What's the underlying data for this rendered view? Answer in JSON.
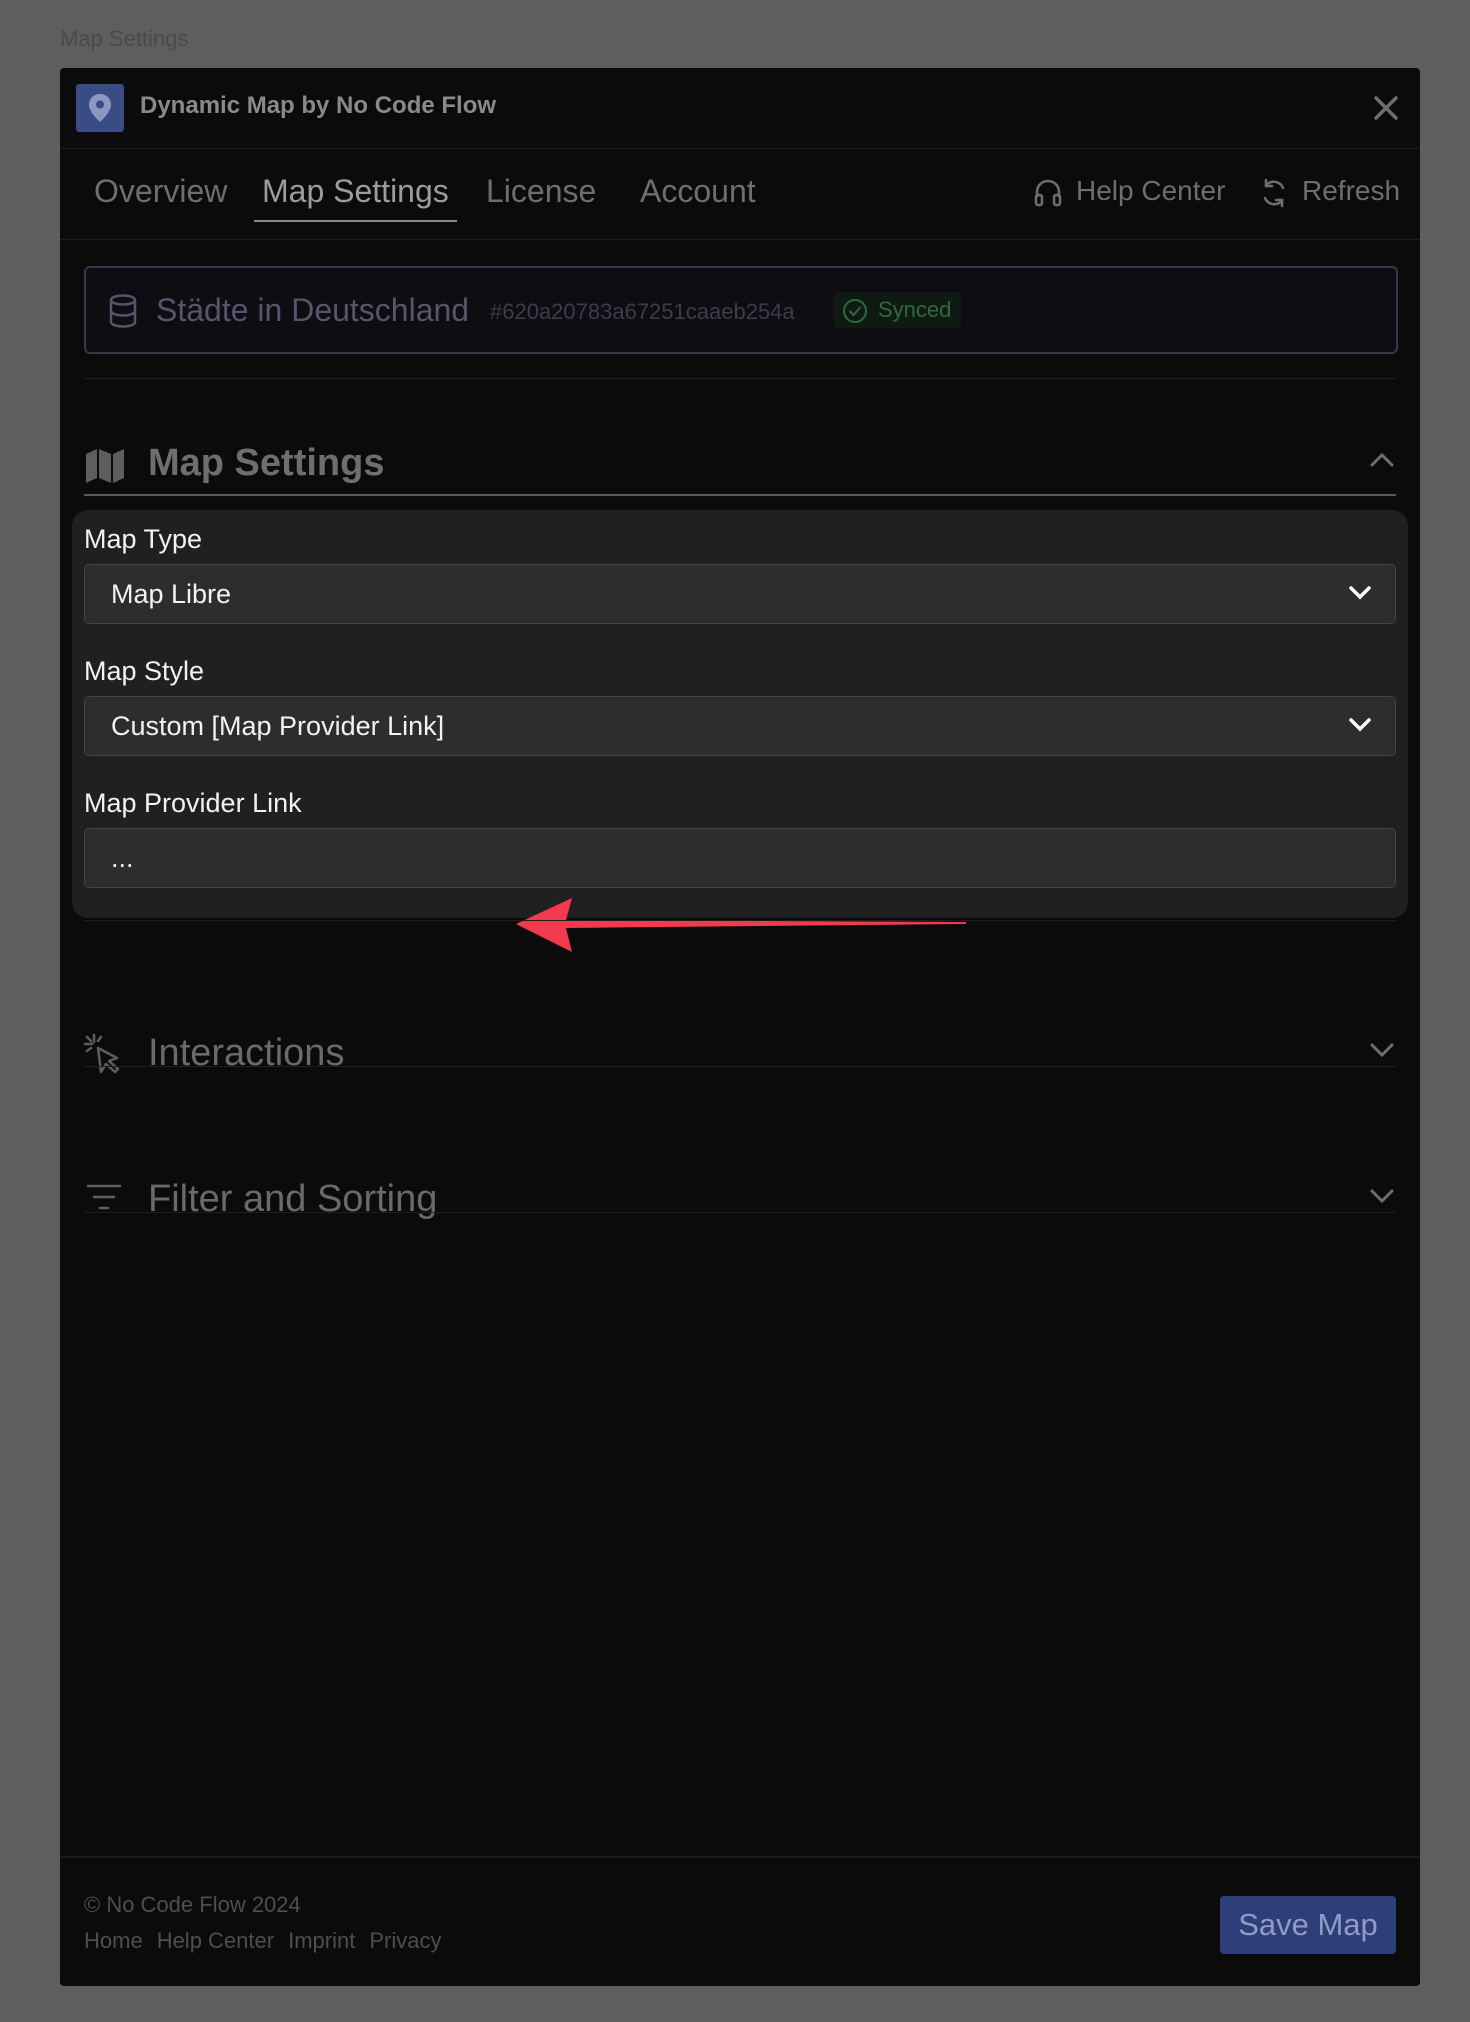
{
  "page": {
    "caption": "Map Settings"
  },
  "modal": {
    "title": "Dynamic Map by No Code Flow",
    "tabs": [
      {
        "label": "Overview",
        "active": false
      },
      {
        "label": "Map Settings",
        "active": true
      },
      {
        "label": "License",
        "active": false
      },
      {
        "label": "Account",
        "active": false
      }
    ],
    "help_label": "Help Center",
    "refresh_label": "Refresh"
  },
  "collection": {
    "name": "Städte in Deutschland",
    "id": "#620a20783a67251caaeb254a",
    "status": "Synced"
  },
  "map_settings": {
    "section_title": "Map Settings",
    "expanded": true,
    "map_type": {
      "label": "Map Type",
      "value": "Map Libre"
    },
    "map_style": {
      "label": "Map Style",
      "value": "Custom [Map Provider Link]"
    },
    "provider_link": {
      "label": "Map Provider Link",
      "value": "..."
    }
  },
  "sections": {
    "interactions": {
      "title": "Interactions",
      "expanded": false
    },
    "filter_sorting": {
      "title": "Filter and Sorting",
      "expanded": false
    }
  },
  "footer": {
    "copyright": "© No Code Flow 2024",
    "links": [
      "Home",
      "Help Center",
      "Imprint",
      "Privacy"
    ],
    "save_label": "Save Map"
  },
  "colors": {
    "accent": "#2d3e79",
    "synced": "#2c6b3e",
    "annotation_arrow": "#f23a4f"
  }
}
